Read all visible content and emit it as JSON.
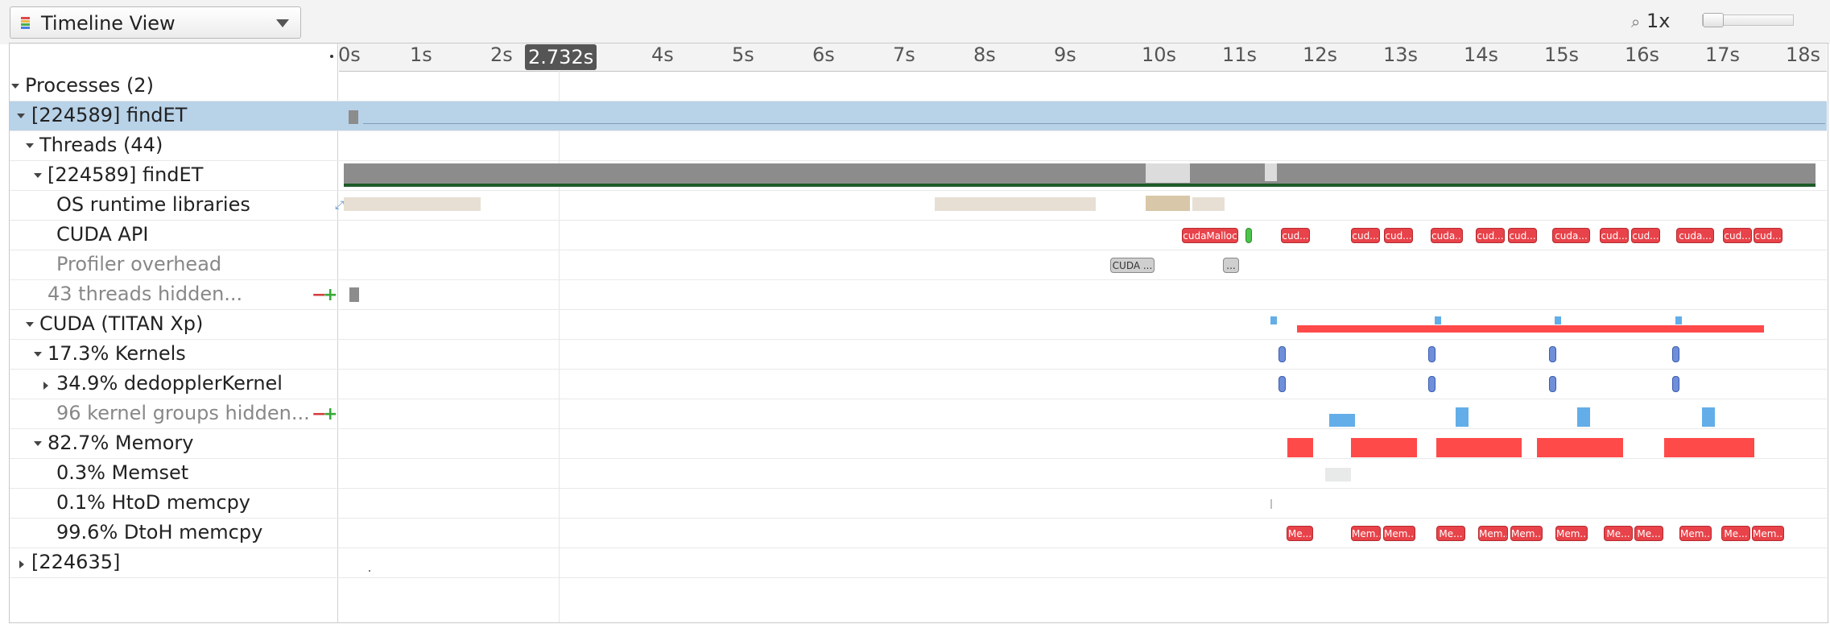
{
  "toolbar": {
    "view_label": "Timeline View",
    "zoom_label": "1x",
    "zoom_icon": "magnifier-icon"
  },
  "ruler": {
    "ticks": [
      "0s",
      "1s",
      "2s",
      "3s",
      "4s",
      "5s",
      "6s",
      "7s",
      "8s",
      "9s",
      "10s",
      "11s",
      "12s",
      "13s",
      "14s",
      "15s",
      "16s",
      "17s",
      "18s"
    ],
    "cursor_label": "2.732s"
  },
  "tree": {
    "processes": "Processes (2)",
    "proc1": "[224589] findET",
    "threads": "Threads (44)",
    "thread_main": "[224589] findET",
    "os_runtime": "OS runtime libraries",
    "cuda_api": "CUDA API",
    "profiler_overhead": "Profiler overhead",
    "threads_hidden": "43 threads hidden...",
    "cuda_device": "CUDA (TITAN Xp)",
    "kernels": "17.3% Kernels",
    "dedoppler": "34.9% dedopplerKernel",
    "kernel_groups_hidden": "96 kernel groups hidden...",
    "memory": "82.7% Memory",
    "memset": "0.3% Memset",
    "htod": "0.1% HtoD memcpy",
    "dtoh": "99.6% DtoH memcpy",
    "proc2": "[224635]"
  },
  "labels": {
    "cuda_malloc": "cudaMalloc",
    "cuda_short": "cud...",
    "cuda_mid": "cuda...",
    "cuda_overhead": "CUDA ...",
    "ellipsis": "...",
    "mem_short": "Mem...",
    "me_short": "Me..."
  },
  "colors": {
    "cpu_gray": "#8c8c8c",
    "dark_green": "#1e5a28",
    "cuda_red": "#e8434a",
    "kernel_blue": "#6f8fd8",
    "light_blue": "#63aee8",
    "memory_red": "#ff4a4a",
    "selection": "#b8d2e8"
  }
}
